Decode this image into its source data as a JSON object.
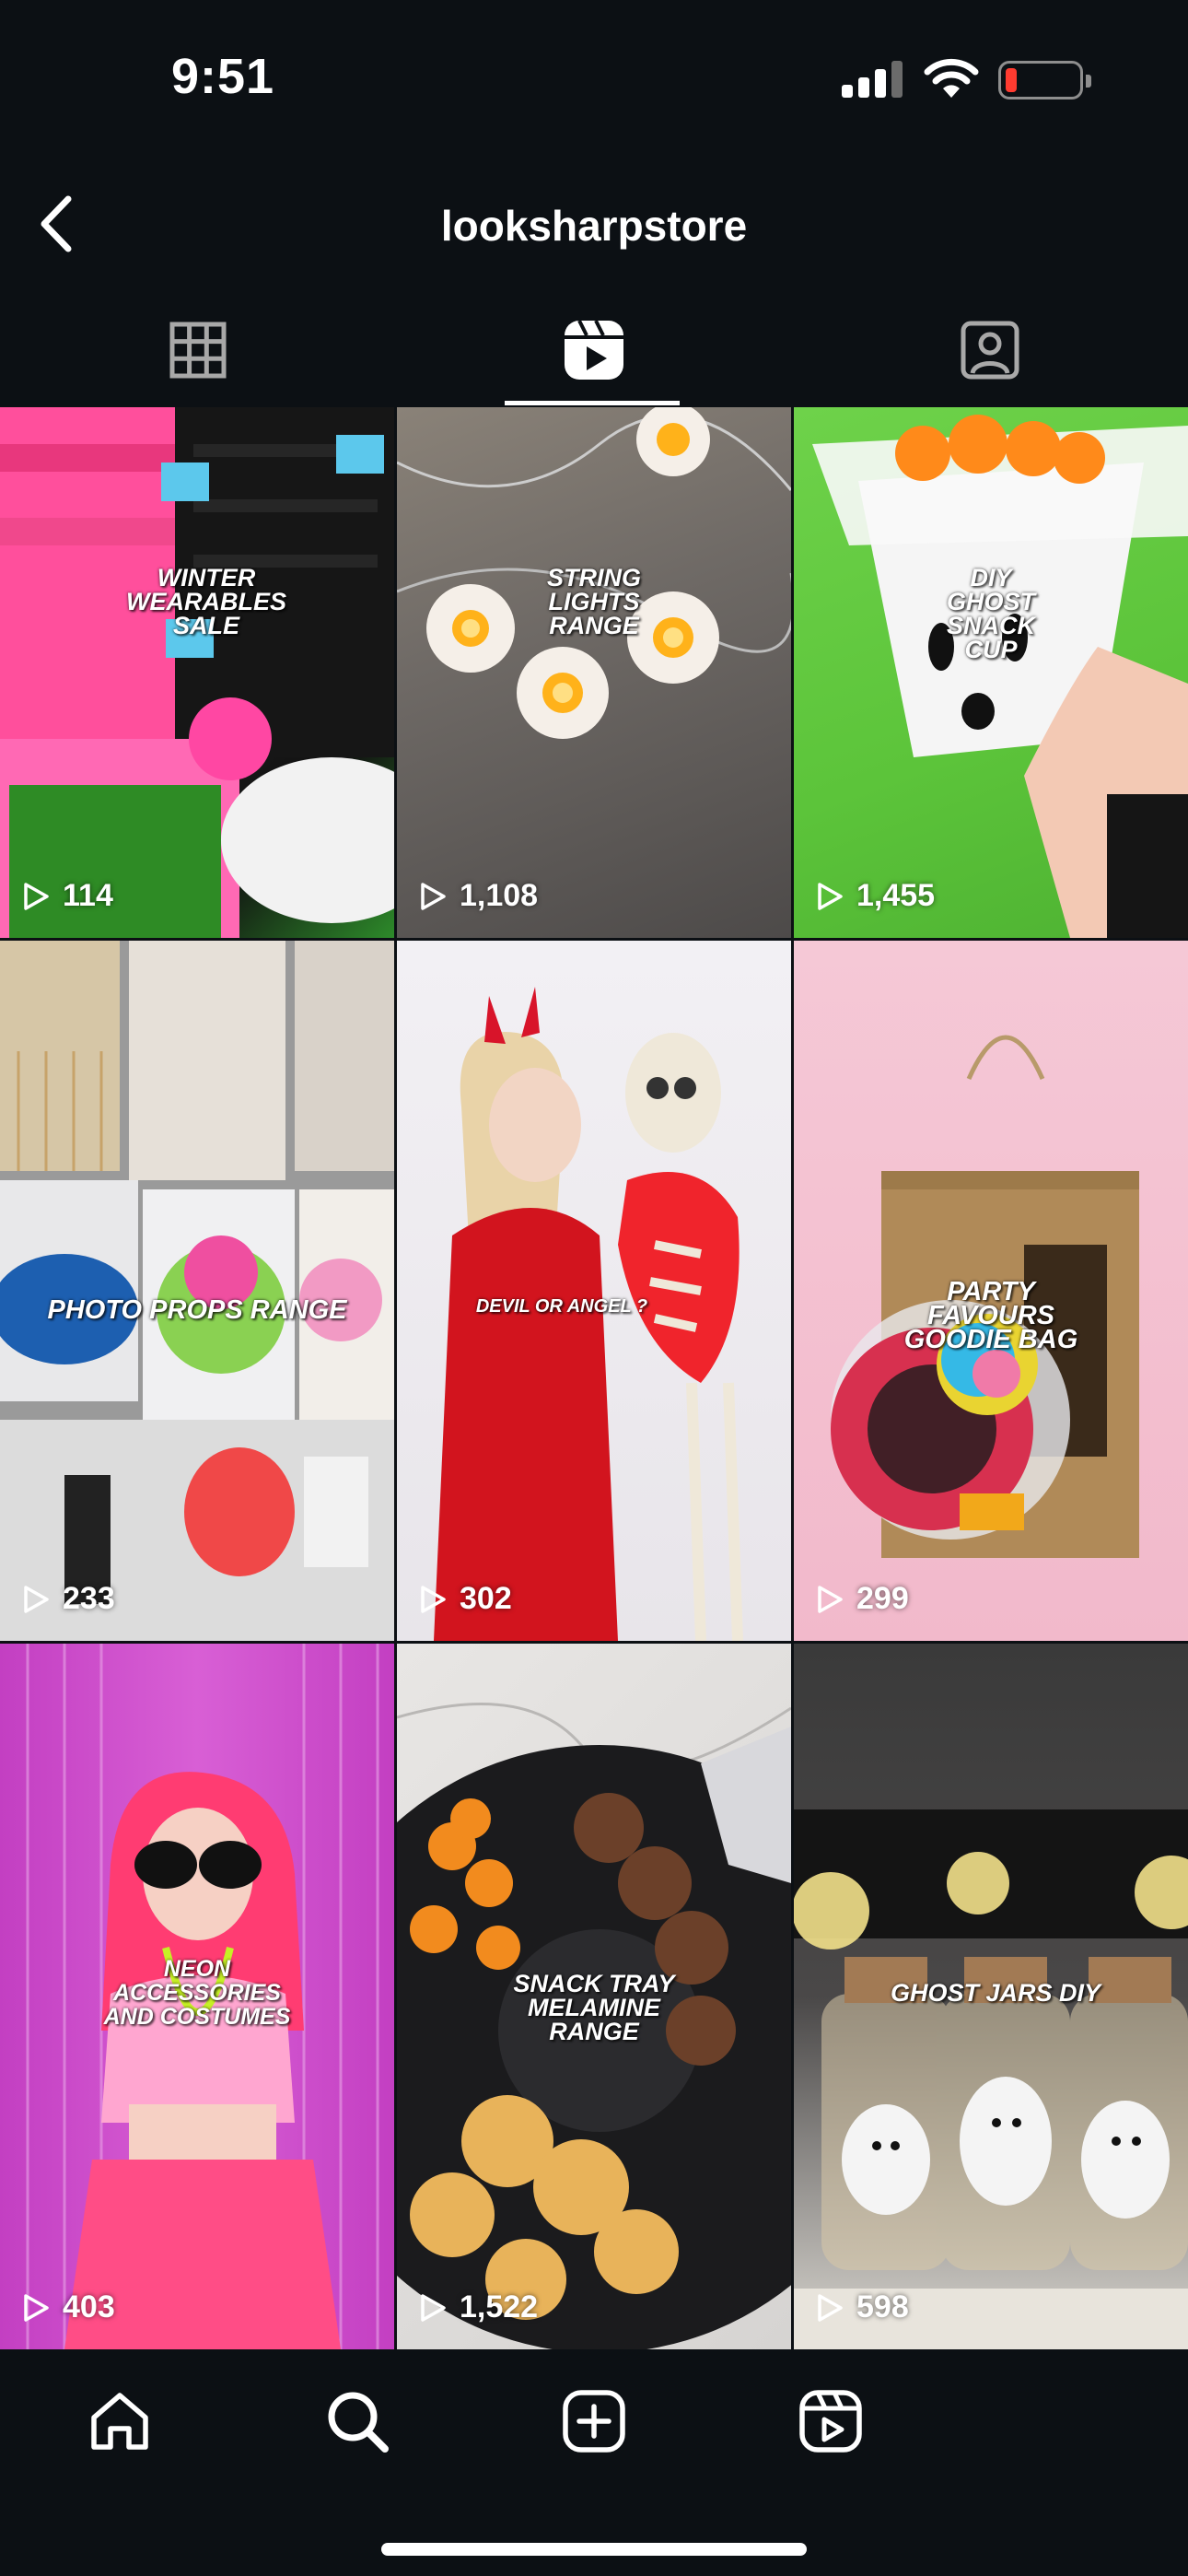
{
  "status_bar": {
    "time": "9:51"
  },
  "header": {
    "title": "looksharpstore"
  },
  "tabs": [
    {
      "name": "posts",
      "icon": "grid-icon",
      "active": false
    },
    {
      "name": "reels",
      "icon": "reels-icon",
      "active": true
    },
    {
      "name": "tagged",
      "icon": "tagged-icon",
      "active": false
    }
  ],
  "reels": [
    {
      "caption": "WINTER WEARABLES SALE",
      "views": "114"
    },
    {
      "caption": "STRING LIGHTS RANGE",
      "views": "1,108"
    },
    {
      "caption": "DIY GHOST SNACK CUP",
      "views": "1,455"
    },
    {
      "caption": "PHOTO PROPS RANGE",
      "views": "233"
    },
    {
      "caption": "DEVIL OR ANGEL ?",
      "views": "302"
    },
    {
      "caption": "PARTY FAVOURS GOODIE BAG",
      "views": "299"
    },
    {
      "caption": "NEON ACCESSORIES AND COSTUMES",
      "views": "403"
    },
    {
      "caption": "SNACK TRAY MELAMINE RANGE",
      "views": "1,522"
    },
    {
      "caption": "GHOST JARS DIY",
      "views": "598"
    }
  ],
  "bottom_nav": [
    {
      "name": "home",
      "icon": "home-icon"
    },
    {
      "name": "search",
      "icon": "search-icon"
    },
    {
      "name": "create",
      "icon": "plus-square-icon"
    },
    {
      "name": "reels",
      "icon": "reels-icon"
    }
  ],
  "colors": {
    "background": "#0c1014",
    "text": "#ffffff",
    "battery_low": "#ff3b30"
  }
}
